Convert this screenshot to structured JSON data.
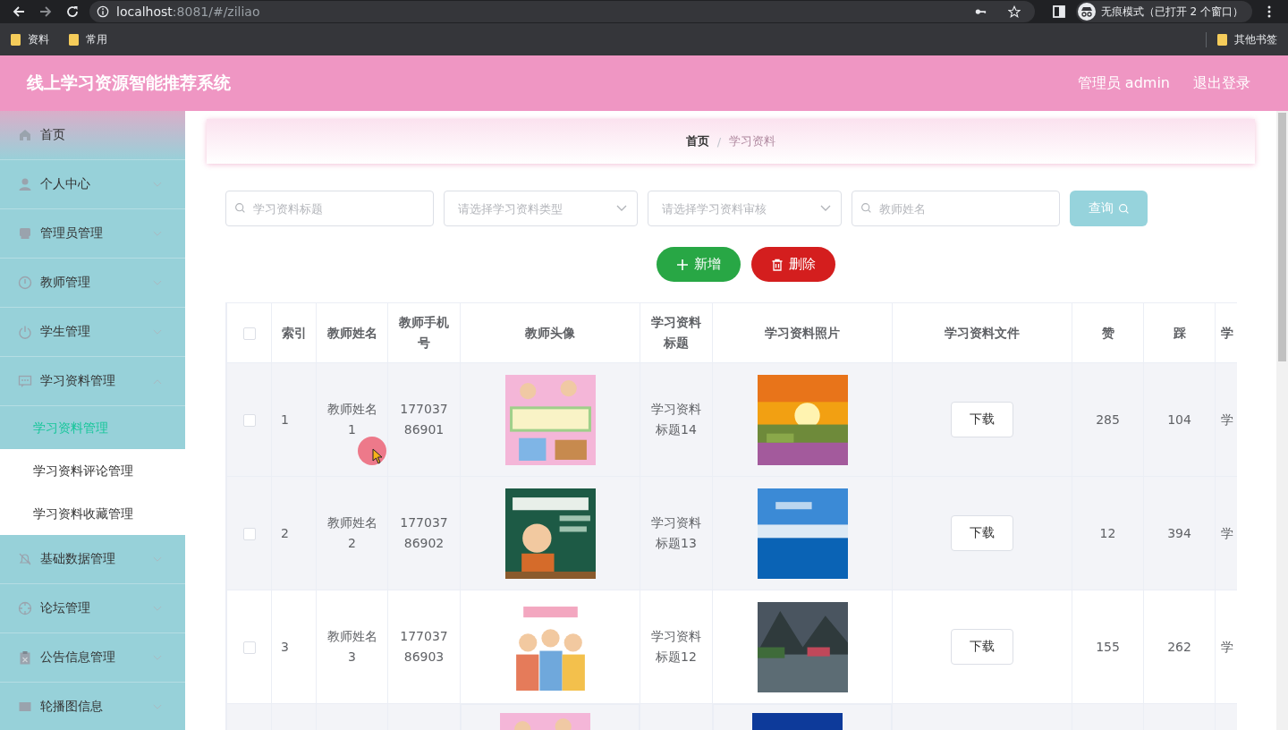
{
  "browser": {
    "url_host": "localhost",
    "url_rest": ":8081/#/ziliao",
    "profile": "无痕模式（已打开 2 个窗口）",
    "bookmarks": [
      "资料",
      "常用"
    ],
    "other_bookmarks": "其他书签"
  },
  "header": {
    "title": "线上学习资源智能推荐系统",
    "user": "管理员 admin",
    "logout": "退出登录"
  },
  "sidebar": {
    "items": [
      {
        "label": "首页",
        "expandable": false
      },
      {
        "label": "个人中心",
        "expandable": true,
        "expanded": false
      },
      {
        "label": "管理员管理",
        "expandable": true,
        "expanded": false
      },
      {
        "label": "教师管理",
        "expandable": true,
        "expanded": false
      },
      {
        "label": "学生管理",
        "expandable": true,
        "expanded": false
      },
      {
        "label": "学习资料管理",
        "expandable": true,
        "expanded": true,
        "children": [
          {
            "label": "学习资料管理",
            "selected": true
          },
          {
            "label": "学习资料评论管理",
            "selected": false
          },
          {
            "label": "学习资料收藏管理",
            "selected": false
          }
        ]
      },
      {
        "label": "基础数据管理",
        "expandable": true,
        "expanded": false
      },
      {
        "label": "论坛管理",
        "expandable": true,
        "expanded": false
      },
      {
        "label": "公告信息管理",
        "expandable": true,
        "expanded": false
      },
      {
        "label": "轮播图信息",
        "expandable": true,
        "expanded": false
      }
    ]
  },
  "breadcrumb": [
    "首页",
    "学习资料"
  ],
  "breadcrumb_separator": "/",
  "filters": [
    {
      "kind": "search",
      "placeholder": "学习资料标题"
    },
    {
      "kind": "select",
      "placeholder": "请选择学习资料类型"
    },
    {
      "kind": "select",
      "placeholder": "请选择学习资料审核"
    },
    {
      "kind": "search",
      "placeholder": "教师姓名"
    }
  ],
  "query_button": "查询",
  "actions": [
    {
      "kind": "add",
      "label": "新增"
    },
    {
      "kind": "delete",
      "label": "删除"
    }
  ],
  "table": {
    "select_all_checked": false,
    "columns": [
      "索引",
      "教师姓名",
      "教师手机号",
      "教师头像",
      "学习资料标题",
      "学习资料照片",
      "学习资料文件",
      "赞",
      "踩",
      "学"
    ],
    "rows": [
      {
        "kind": "full",
        "highlighted": true,
        "checked": false,
        "index": "1",
        "teacher": "教师姓名1",
        "phone": "17703786901",
        "title": "学习资料标题14",
        "file": "下载",
        "likes": "285",
        "dislikes": "104",
        "column_10": "学"
      },
      {
        "kind": "full",
        "highlighted": true,
        "checked": false,
        "index": "2",
        "teacher": "教师姓名2",
        "phone": "17703786902",
        "title": "学习资料标题13",
        "file": "下载",
        "likes": "12",
        "dislikes": "394",
        "column_10": "学"
      },
      {
        "kind": "full",
        "highlighted": false,
        "checked": false,
        "index": "3",
        "teacher": "教师姓名3",
        "phone": "17703786903",
        "title": "学习资料标题12",
        "file": "下载",
        "likes": "155",
        "dislikes": "262",
        "column_10": "学"
      },
      {
        "kind": "cut_off",
        "highlighted": true
      }
    ]
  }
}
